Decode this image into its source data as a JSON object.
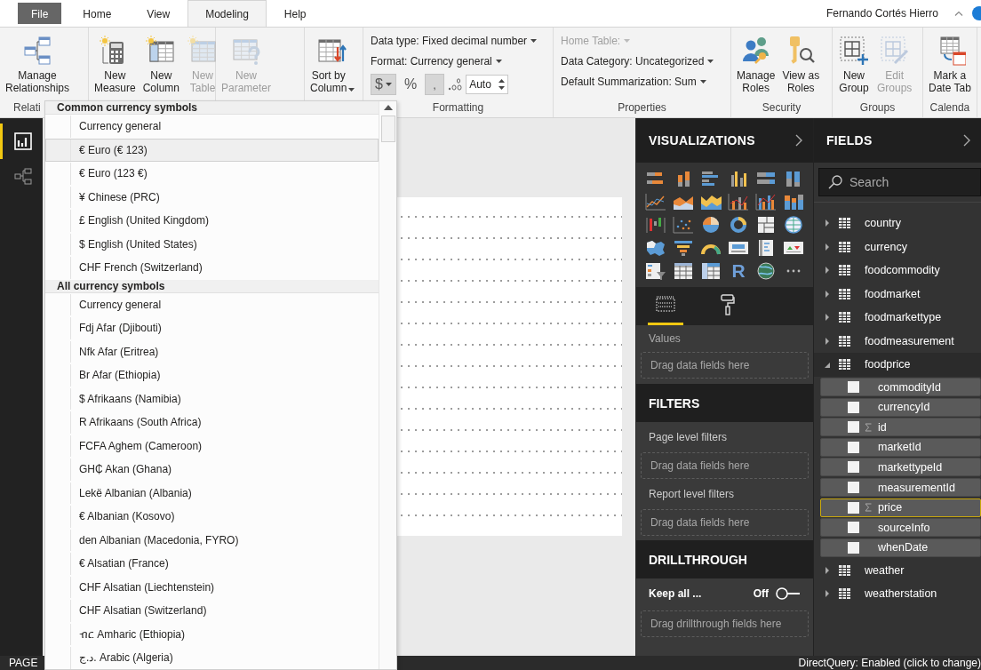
{
  "tabs": [
    {
      "label": "File",
      "kind": "file",
      "selected": false
    },
    {
      "label": "Home",
      "kind": "tab",
      "selected": false
    },
    {
      "label": "View",
      "kind": "tab",
      "selected": false
    },
    {
      "label": "Modeling",
      "kind": "tab",
      "selected": true
    },
    {
      "label": "Help",
      "kind": "tab",
      "selected": false
    }
  ],
  "user": "Fernando Cortés Hierro",
  "ribbon": [
    {
      "kind": "buttons",
      "label": "Relati",
      "buttons": [
        {
          "kind": "relationships",
          "label": "Manage\nRelationships",
          "disabled": false,
          "dropdown": false
        }
      ]
    },
    {
      "kind": "buttons",
      "buttons": [
        {
          "kind": "measure",
          "label": "New\nMeasure",
          "disabled": false,
          "dropdown": false
        },
        {
          "kind": "column",
          "label": "New\nColumn",
          "disabled": false,
          "dropdown": false
        },
        {
          "kind": "table",
          "label": "New\nTable",
          "disabled": true,
          "dropdown": false
        }
      ]
    },
    {
      "kind": "buttons",
      "buttons": [
        {
          "kind": "parameter",
          "label": "New\nParameter",
          "disabled": true,
          "dropdown": false
        }
      ]
    },
    {
      "kind": "buttons",
      "buttons": [
        {
          "kind": "sort",
          "label": "Sort by\nColumn",
          "disabled": false,
          "dropdown": true
        }
      ]
    },
    {
      "kind": "format",
      "label": "Formatting",
      "menus": [
        {
          "label": "Data type: Fixed decimal number",
          "disabled": false
        },
        {
          "label": "Format: Currency general",
          "disabled": false
        }
      ],
      "controls": [
        {
          "kind": "currency",
          "label": "$",
          "pressed": true
        },
        {
          "kind": "percent",
          "label": "%",
          "pressed": false
        },
        {
          "kind": "comma",
          "label": ",",
          "pressed": true
        },
        {
          "kind": "decimals"
        },
        {
          "kind": "spin",
          "value": "Auto"
        }
      ]
    },
    {
      "kind": "menus",
      "label": "Properties",
      "menus": [
        {
          "label": "Home Table:",
          "disabled": true
        },
        {
          "label": "Data Category: Uncategorized",
          "disabled": false
        },
        {
          "label": "Default Summarization: Sum",
          "disabled": false
        }
      ]
    },
    {
      "kind": "buttons",
      "label": "Security",
      "buttons": [
        {
          "kind": "roles",
          "label": "Manage\nRoles",
          "disabled": false,
          "dropdown": false
        },
        {
          "kind": "viewroles",
          "label": "View as\nRoles",
          "disabled": false,
          "dropdown": false
        }
      ]
    },
    {
      "kind": "buttons",
      "label": "Groups",
      "buttons": [
        {
          "kind": "newgroup",
          "label": "New\nGroup",
          "disabled": false,
          "dropdown": false
        },
        {
          "kind": "editgroups",
          "label": "Edit\nGroups",
          "disabled": true,
          "dropdown": false
        }
      ]
    },
    {
      "kind": "buttons",
      "label": "Calenda",
      "buttons": [
        {
          "kind": "datetable",
          "label": "Mark a\nDate Tab",
          "disabled": false,
          "dropdown": false
        }
      ]
    }
  ],
  "views": [
    {
      "kind": "report",
      "selected": true
    },
    {
      "kind": "model",
      "selected": false
    }
  ],
  "dropdown": {
    "sections": [
      {
        "heading": "Common currency symbols",
        "items": [
          {
            "label": "Currency general",
            "selected": false
          },
          {
            "label": "€ Euro (€ 123)",
            "selected": true
          },
          {
            "label": "€ Euro (123 €)",
            "selected": false
          },
          {
            "label": "¥ Chinese (PRC)",
            "selected": false
          },
          {
            "label": "£ English (United Kingdom)",
            "selected": false
          },
          {
            "label": "$ English (United States)",
            "selected": false
          },
          {
            "label": "CHF French (Switzerland)",
            "selected": false
          }
        ]
      },
      {
        "heading": "All currency symbols",
        "items": [
          {
            "label": "Currency general",
            "selected": false
          },
          {
            "label": "Fdj Afar (Djibouti)",
            "selected": false
          },
          {
            "label": "Nfk Afar (Eritrea)",
            "selected": false
          },
          {
            "label": "Br Afar (Ethiopia)",
            "selected": false
          },
          {
            "label": "$ Afrikaans (Namibia)",
            "selected": false
          },
          {
            "label": "R Afrikaans (South Africa)",
            "selected": false
          },
          {
            "label": "FCFA Aghem (Cameroon)",
            "selected": false
          },
          {
            "label": "GH₵ Akan (Ghana)",
            "selected": false
          },
          {
            "label": "Lekë Albanian (Albania)",
            "selected": false
          },
          {
            "label": "€ Albanian (Kosovo)",
            "selected": false
          },
          {
            "label": "den Albanian (Macedonia, FYRO)",
            "selected": false
          },
          {
            "label": "€ Alsatian (France)",
            "selected": false
          },
          {
            "label": "CHF Alsatian (Liechtenstein)",
            "selected": false
          },
          {
            "label": "CHF Alsatian (Switzerland)",
            "selected": false
          },
          {
            "label": "ብር Amharic (Ethiopia)",
            "selected": false
          },
          {
            "label": "د.ج. Arabic (Algeria)",
            "selected": false
          }
        ]
      }
    ]
  },
  "visualizations": {
    "title": "VISUALIZATIONS",
    "r_label": "R",
    "pane_tabs": [
      {
        "kind": "fields",
        "selected": true
      },
      {
        "kind": "format",
        "selected": false
      }
    ],
    "wells": [
      {
        "label": "Values",
        "placeholder": "Drag data fields here"
      }
    ]
  },
  "filters": {
    "title": "FILTERS",
    "sections": [
      {
        "label": "Page level filters",
        "placeholder": "Drag data fields here"
      },
      {
        "label": "Report level filters",
        "placeholder": "Drag data fields here"
      }
    ]
  },
  "drillthrough": {
    "title": "DRILLTHROUGH",
    "keep_all": {
      "label": "Keep all ...",
      "state": "Off",
      "on": false
    },
    "placeholder": "Drag drillthrough fields here"
  },
  "fields": {
    "title": "FIELDS",
    "search": {
      "placeholder": "Search"
    },
    "tables": [
      {
        "name": "country",
        "expanded": false
      },
      {
        "name": "currency",
        "expanded": false
      },
      {
        "name": "foodcommodity",
        "expanded": false
      },
      {
        "name": "foodmarket",
        "expanded": false
      },
      {
        "name": "foodmarkettype",
        "expanded": false
      },
      {
        "name": "foodmeasurement",
        "expanded": false
      },
      {
        "name": "foodprice",
        "expanded": true,
        "children": [
          {
            "name": "commodityId",
            "checked": false,
            "sum": false,
            "selected": false
          },
          {
            "name": "currencyId",
            "checked": false,
            "sum": false,
            "selected": false
          },
          {
            "name": "id",
            "checked": false,
            "sum": true,
            "selected": false
          },
          {
            "name": "marketId",
            "checked": false,
            "sum": false,
            "selected": false
          },
          {
            "name": "markettypeId",
            "checked": false,
            "sum": false,
            "selected": false
          },
          {
            "name": "measurementId",
            "checked": false,
            "sum": false,
            "selected": false
          },
          {
            "name": "price",
            "checked": false,
            "sum": true,
            "selected": true
          },
          {
            "name": "sourceInfo",
            "checked": false,
            "sum": false,
            "selected": false
          },
          {
            "name": "whenDate",
            "checked": false,
            "sum": false,
            "selected": false
          }
        ]
      },
      {
        "name": "weather",
        "expanded": false
      },
      {
        "name": "weatherstation",
        "expanded": false
      }
    ]
  },
  "status": {
    "page": "PAGE",
    "mode": "DirectQuery: Enabled (click to change)"
  }
}
